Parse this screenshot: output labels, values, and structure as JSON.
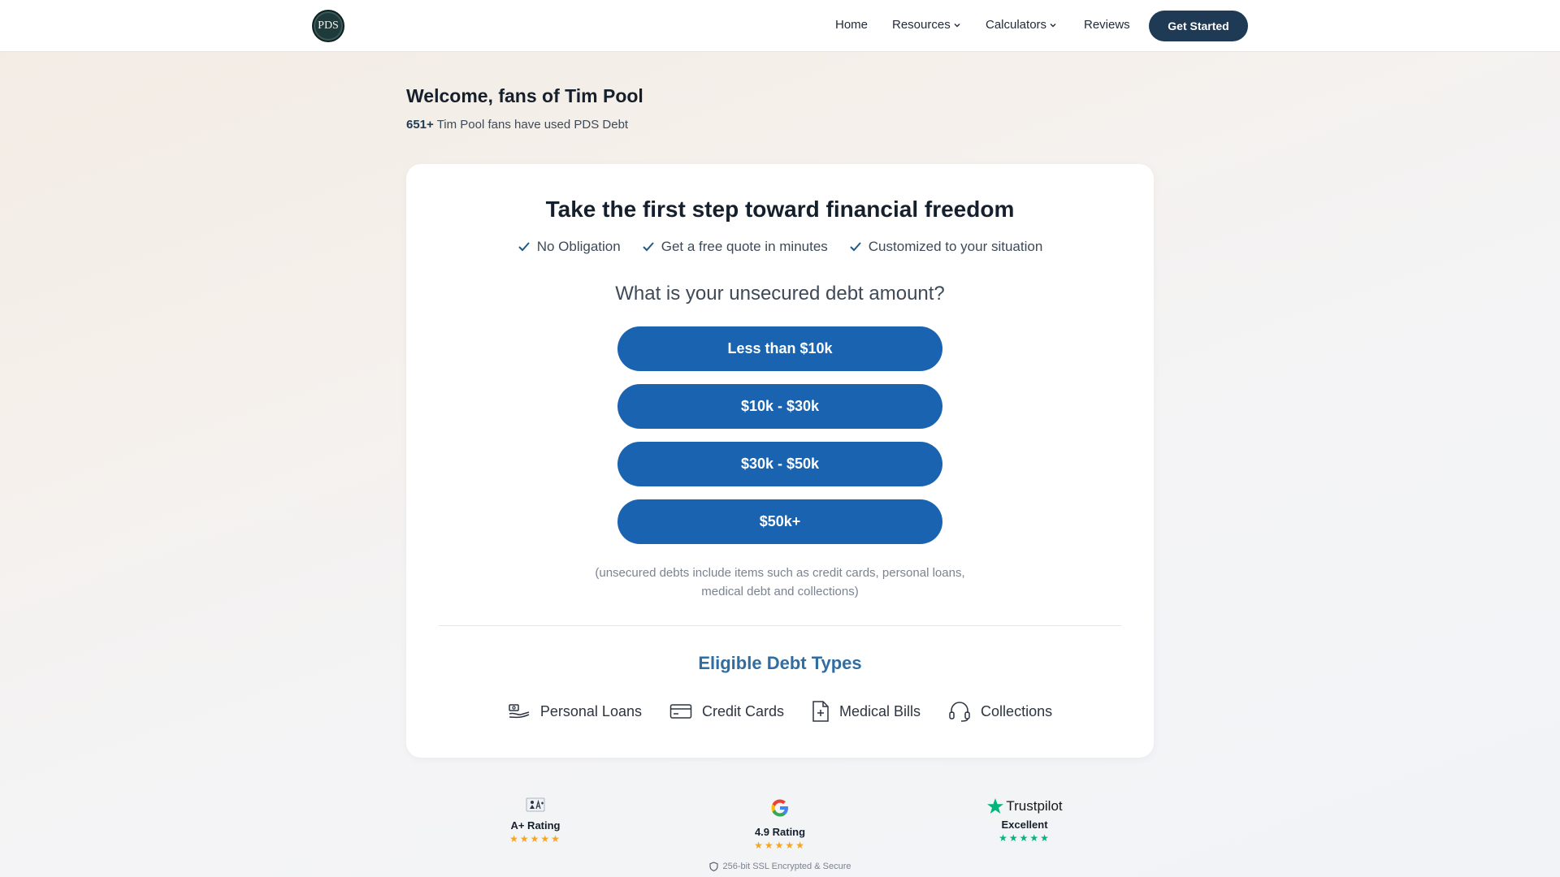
{
  "brand": {
    "logo_text": "PDS"
  },
  "nav": {
    "home": "Home",
    "resources": "Resources",
    "calculators": "Calculators",
    "reviews": "Reviews",
    "cta": "Get Started"
  },
  "welcome": {
    "title": "Welcome, fans of Tim Pool",
    "count": "651+",
    "subtitle": " Tim Pool fans have used PDS Debt"
  },
  "card": {
    "title": "Take the first step toward financial freedom",
    "benefits": [
      "No Obligation",
      "Get a free quote in minutes",
      "Customized to your situation"
    ],
    "question": "What is your unsecured debt amount?",
    "options": [
      "Less than $10k",
      "$10k - $30k",
      "$30k - $50k",
      "$50k+"
    ],
    "note_line1": "(unsecured debts include items such as credit cards, personal loans,",
    "note_line2": "medical debt and collections)",
    "eligible_title": "Eligible Debt Types",
    "debt_types": [
      "Personal Loans",
      "Credit Cards",
      "Medical Bills",
      "Collections"
    ]
  },
  "ratings": [
    {
      "badge": "A+ Rating",
      "stars": "★★★★★",
      "star_color": "#f4a623"
    },
    {
      "badge": "4.9 Rating",
      "stars": "★★★★★",
      "star_color": "#f4a623"
    },
    {
      "brand": "Trustpilot",
      "badge": "Excellent",
      "stars": "★★★★★",
      "star_color": "#00b67a"
    }
  ],
  "security": "256-bit SSL Encrypted & Secure",
  "colors": {
    "primary_button": "#1a63b0",
    "cta": "#1e3a54",
    "heading_accent": "#2f6da3"
  }
}
